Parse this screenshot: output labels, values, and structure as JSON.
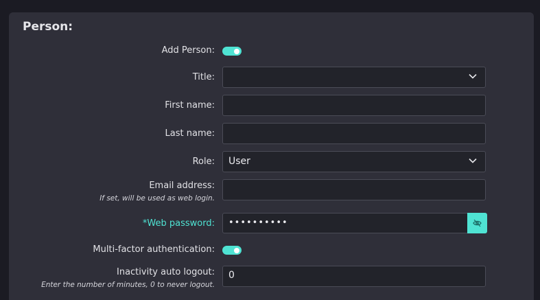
{
  "section": {
    "title": "Person:"
  },
  "fields": {
    "add_person": {
      "label": "Add Person:",
      "enabled": true
    },
    "title": {
      "label": "Title:",
      "value": ""
    },
    "first_name": {
      "label": "First name:",
      "value": ""
    },
    "last_name": {
      "label": "Last name:",
      "value": ""
    },
    "role": {
      "label": "Role:",
      "value": "User"
    },
    "email": {
      "label": "Email address:",
      "hint": "If set, will be used as web login.",
      "value": ""
    },
    "web_password": {
      "label": "*Web password:",
      "value": "••••••••••"
    },
    "mfa": {
      "label": "Multi-factor authentication:",
      "enabled": true
    },
    "inactivity": {
      "label": "Inactivity auto logout:",
      "hint": "Enter the number of minutes, 0 to never logout.",
      "value": "0"
    }
  },
  "icons": {
    "select_chevron": "chevron-down-icon",
    "password_toggle": "eye-slash-icon"
  },
  "colors": {
    "accent": "#4fe3d3",
    "panel": "#2f2f39",
    "background": "#1b1b23",
    "input_bg": "#22232a"
  }
}
